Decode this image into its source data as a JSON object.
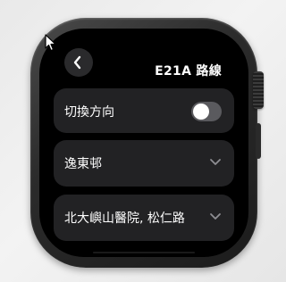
{
  "header": {
    "title": "E21A 路線",
    "back_icon": "chevron-left-icon"
  },
  "rows": [
    {
      "label": "切換方向",
      "control": "toggle",
      "toggle_on": false
    },
    {
      "label": "逸東邨",
      "control": "chevron-down-icon"
    },
    {
      "label": "北大嶼山醫院, 松仁路",
      "control": "chevron-down-icon"
    }
  ],
  "colors": {
    "screen_bg": "#000000",
    "row_bg": "#222224",
    "toggle_track_off": "#5a5a5e",
    "text": "#ffffff"
  }
}
